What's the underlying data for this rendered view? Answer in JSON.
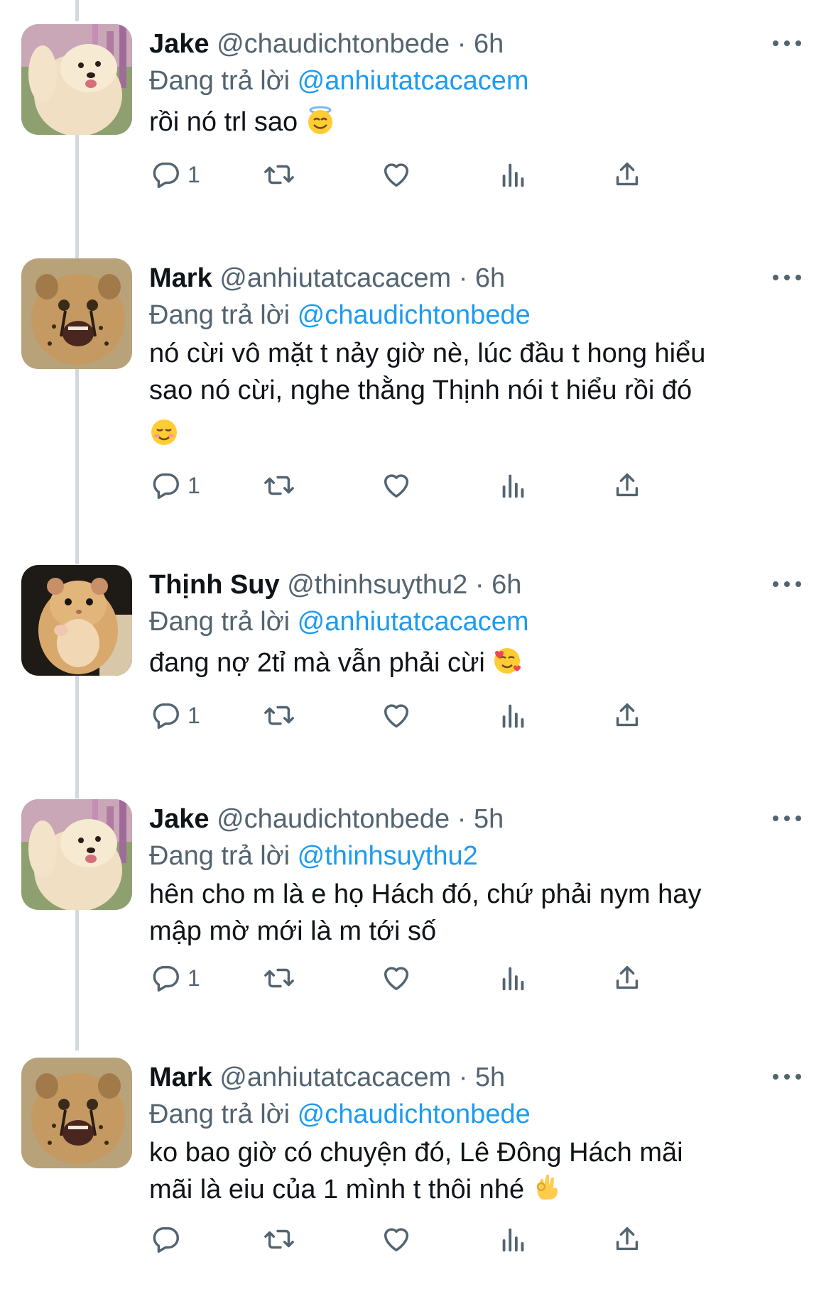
{
  "replying_prefix": "Đang trả lời",
  "colors": {
    "text": "#0f1419",
    "secondary": "#536471",
    "link": "#1d9bf0",
    "thread_line": "#cfd9de"
  },
  "icons": {
    "more": "more-options-icon",
    "reply": "reply-icon",
    "retweet": "retweet-icon",
    "like": "heart-icon",
    "views": "views-icon",
    "share": "share-icon"
  },
  "tweets": [
    {
      "name": "Jake",
      "handle": "@chaudichtonbede",
      "dot": "·",
      "time": "6h",
      "replying_to": "@anhiutatcacacem",
      "text_lines": [
        "rồi nó trl sao"
      ],
      "emoji": "smiling-face-with-halo-emoji",
      "reply_count": "1"
    },
    {
      "name": "Mark",
      "handle": "@anhiutatcacacem",
      "dot": "·",
      "time": "6h",
      "replying_to": "@chaudichtonbede",
      "text_lines": [
        "nó cừi vô mặt t nảy giờ nè, lúc đầu t hong hiểu",
        "sao nó cừi, nghe thằng Thịnh nói t hiểu rồi đó"
      ],
      "emoji": "smiling-face-emoji",
      "reply_count": "1"
    },
    {
      "name": "Thịnh Suy",
      "handle": "@thinhsuythu2",
      "dot": "·",
      "time": "6h",
      "replying_to": "@anhiutatcacacem",
      "text_lines": [
        "đang nợ 2tỉ mà vẫn phải cừi"
      ],
      "emoji": "smiling-face-with-hearts-emoji",
      "reply_count": "1"
    },
    {
      "name": "Jake",
      "handle": "@chaudichtonbede",
      "dot": "·",
      "time": "5h",
      "replying_to": "@thinhsuythu2",
      "text_lines": [
        "hên cho m là e họ Hách đó, chứ phải nym hay",
        "mập mờ mới là m tới số"
      ],
      "emoji": "",
      "reply_count": "1"
    },
    {
      "name": "Mark",
      "handle": "@anhiutatcacacem",
      "dot": "·",
      "time": "5h",
      "replying_to": "@chaudichtonbede",
      "text_lines": [
        "ko bao giờ có chuyện đó, Lê Đông Hách mãi",
        "mãi là eiu của 1 mình t thôi nhé"
      ],
      "emoji": "ok-hand-emoji",
      "reply_count": ""
    }
  ]
}
